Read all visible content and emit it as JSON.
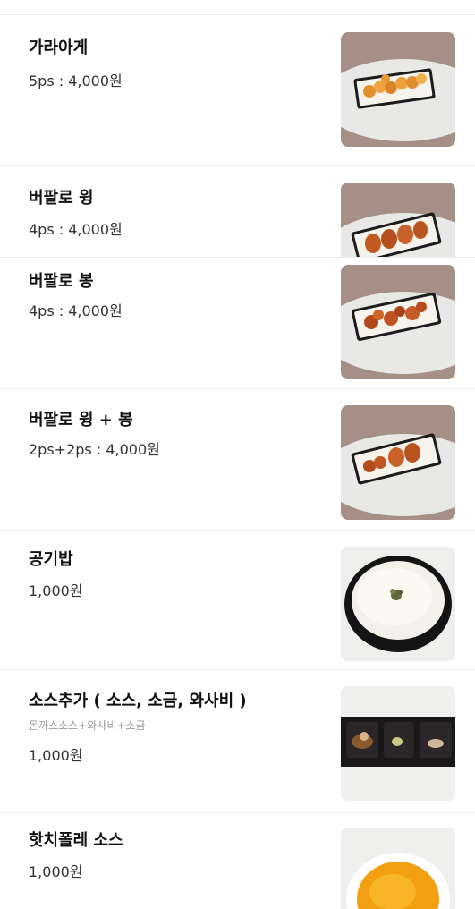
{
  "menu": {
    "items": [
      {
        "name": "가라아게",
        "price": "5ps : 4,000원",
        "image": "karaage-photo"
      },
      {
        "name": "버팔로 윙",
        "price": "4ps : 4,000원",
        "image": "buffalo-wing-photo"
      },
      {
        "name": "버팔로 봉",
        "price": "4ps : 4,000원",
        "image": "buffalo-drumette-photo"
      },
      {
        "name": "버팔로 윙 + 봉",
        "price": "2ps+2ps : 4,000원",
        "image": "buffalo-wing-drumette-photo"
      },
      {
        "name": "공기밥",
        "price": "1,000원",
        "image": "rice-bowl-photo"
      },
      {
        "name": "소스추가 ( 소스, 소금, 와사비 )",
        "description": "돈까스소스+와사비+소금",
        "price": "1,000원",
        "image": "sauce-tray-photo"
      },
      {
        "name": "핫치폴레 소스",
        "price": "1,000원",
        "image": "hot-chipotle-sauce-photo"
      }
    ]
  }
}
